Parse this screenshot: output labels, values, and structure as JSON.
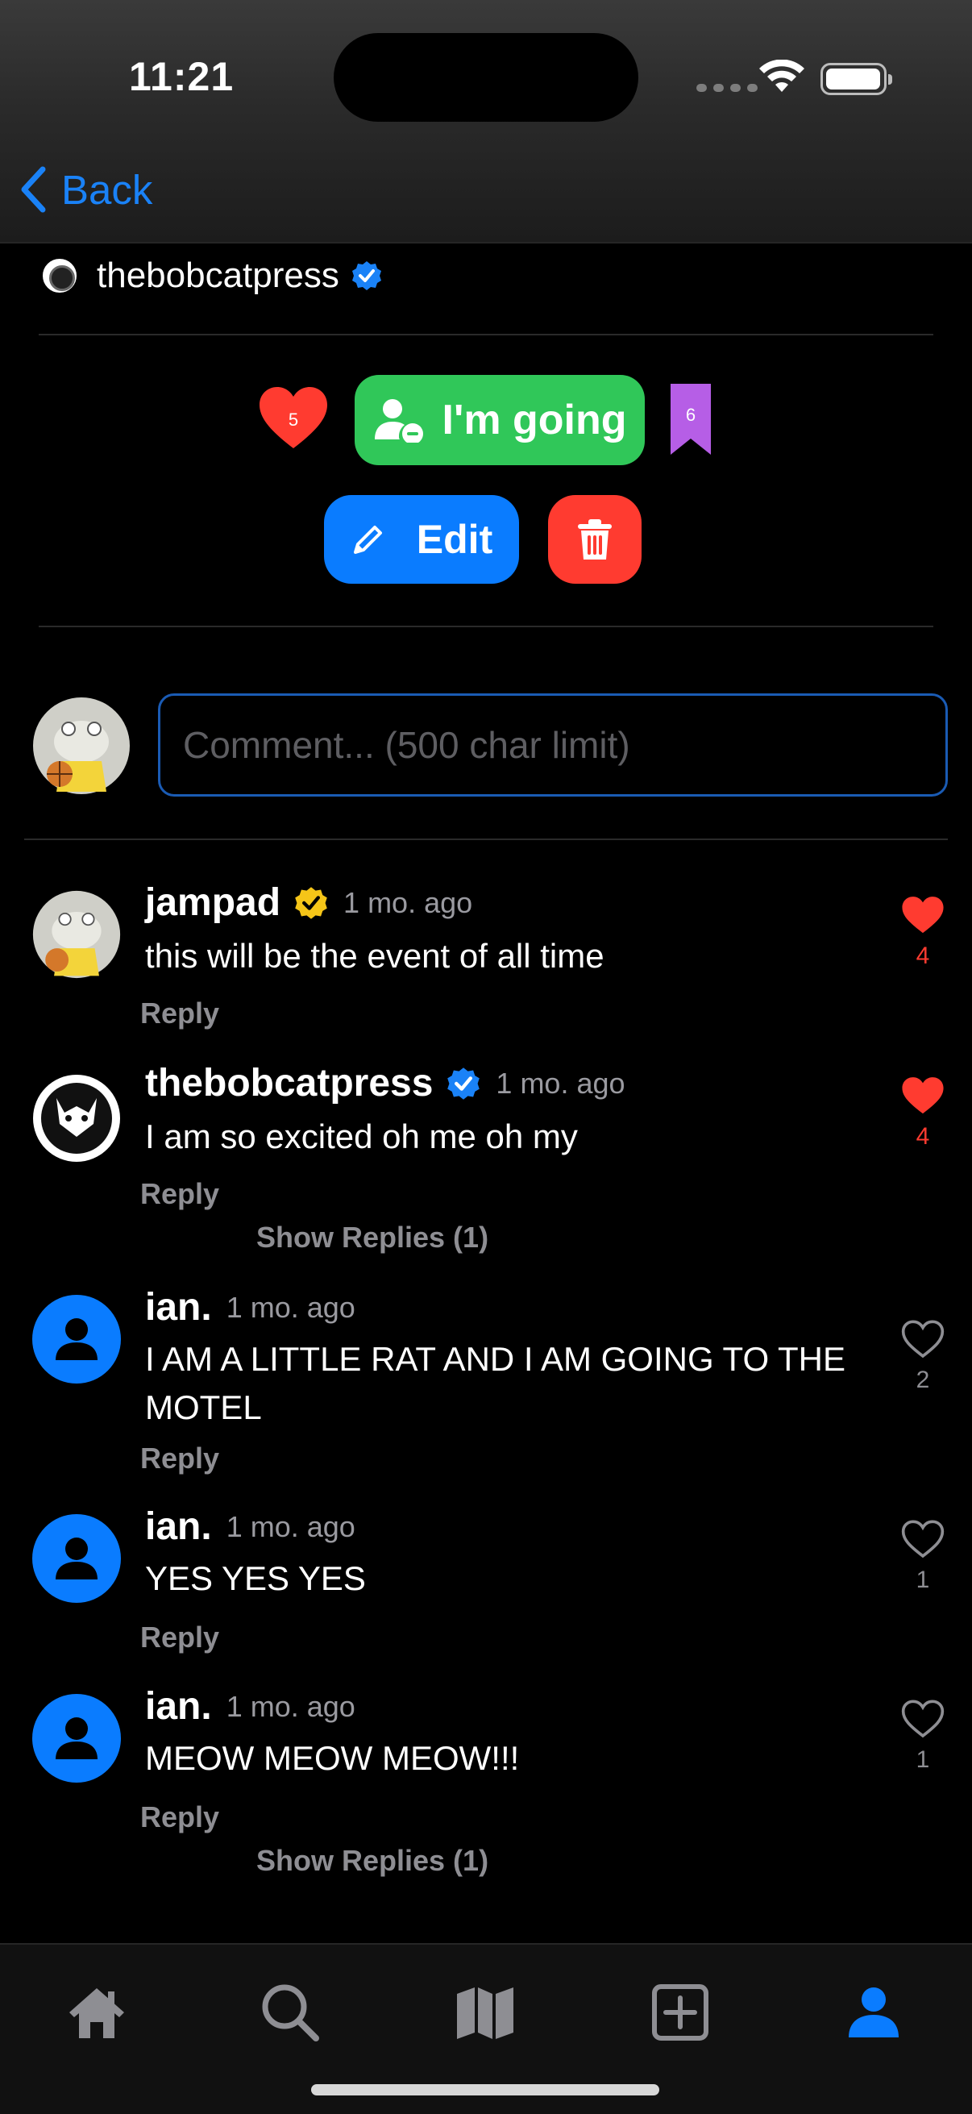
{
  "status": {
    "time": "11:21"
  },
  "nav": {
    "back_label": "Back"
  },
  "post": {
    "author": "thebobcatpress"
  },
  "actions": {
    "like_count": "5",
    "going_label": "I'm going",
    "bookmark_count": "6",
    "edit_label": "Edit"
  },
  "comment_input": {
    "placeholder": "Comment... (500 char limit)"
  },
  "comments": [
    {
      "user": "jampad",
      "badge": "gold",
      "time": "1 mo. ago",
      "text": "this will be the event of all time",
      "reply": "Reply",
      "likes": "4",
      "liked": true
    },
    {
      "user": "thebobcatpress",
      "badge": "blue",
      "time": "1 mo. ago",
      "text": "I am so excited oh me oh my",
      "reply": "Reply",
      "likes": "4",
      "liked": true,
      "show_replies": "Show Replies (1)"
    },
    {
      "user": "ian.",
      "time": "1 mo. ago",
      "text": "I AM A LITTLE RAT AND I AM GOING TO THE MOTEL",
      "reply": "Reply",
      "likes": "2",
      "liked": false
    },
    {
      "user": "ian.",
      "time": "1 mo. ago",
      "text": "YES YES YES",
      "reply": "Reply",
      "likes": "1",
      "liked": false
    },
    {
      "user": "ian.",
      "time": "1 mo. ago",
      "text": "MEOW MEOW MEOW!!!",
      "reply": "Reply",
      "likes": "1",
      "liked": false,
      "show_replies": "Show Replies (1)"
    }
  ],
  "tabs": [
    {
      "icon": "home-icon"
    },
    {
      "icon": "search-icon"
    },
    {
      "icon": "map-icon"
    },
    {
      "icon": "add-icon"
    },
    {
      "icon": "profile-icon",
      "active": true
    }
  ],
  "colors": {
    "accent": "#0a7cff",
    "going_green": "#30c759",
    "delete_red": "#ff3b30",
    "like_red": "#ff3b30",
    "bookmark_purple": "#b65ee6",
    "verified_gold": "#f5c518"
  }
}
